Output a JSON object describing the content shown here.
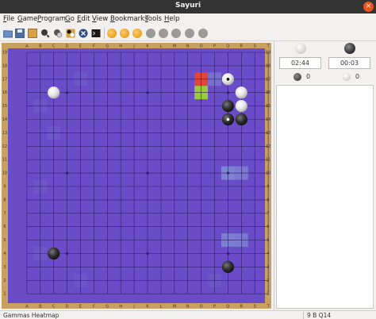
{
  "window": {
    "title": "Sayuri",
    "close_glyph": "×"
  },
  "menu": [
    "File",
    "Game",
    "Program",
    "Go",
    "Edit",
    "View",
    "Bookmarks",
    "Tools",
    "Help"
  ],
  "toolbar": {
    "buttons": [
      "open-icon",
      "save-icon",
      "board-icon",
      "analyze-icon",
      "setup-icon",
      "stop-icon",
      "terminal-icon",
      "play-orange-icon",
      "play-orange-icon-2",
      "play-orange-icon-3",
      "disabled-icon-1",
      "disabled-icon-2",
      "disabled-icon-3",
      "disabled-icon-4",
      "disabled-icon-5"
    ]
  },
  "board": {
    "size": 19,
    "col_labels": [
      "A",
      "B",
      "C",
      "D",
      "E",
      "F",
      "G",
      "H",
      "J",
      "K",
      "L",
      "M",
      "N",
      "O",
      "P",
      "Q",
      "R",
      "S",
      "T"
    ],
    "row_labels": [
      "19",
      "18",
      "17",
      "16",
      "15",
      "14",
      "13",
      "12",
      "11",
      "10",
      "9",
      "8",
      "7",
      "6",
      "5",
      "4",
      "3",
      "2",
      "1"
    ],
    "colors": {
      "wood": "#c8a060",
      "board": "#6a4cc8",
      "line": "#2e1f66",
      "heat": "#8fb0d9"
    },
    "stones": [
      {
        "color": "white",
        "col": 16,
        "row": 17
      },
      {
        "color": "white",
        "col": 3,
        "row": 16
      },
      {
        "color": "white",
        "col": 17,
        "row": 16
      },
      {
        "color": "white",
        "col": 17,
        "row": 15
      },
      {
        "color": "black",
        "col": 16,
        "row": 15
      },
      {
        "color": "black",
        "col": 16,
        "row": 14
      },
      {
        "color": "black",
        "col": 17,
        "row": 14
      },
      {
        "color": "black",
        "col": 3,
        "row": 4
      },
      {
        "color": "black",
        "col": 16,
        "row": 3
      }
    ],
    "markers": [
      {
        "col": 16,
        "row": 17,
        "color": "black"
      },
      {
        "col": 16,
        "row": 14,
        "color": "white"
      }
    ],
    "highlights": [
      {
        "col": 14,
        "row": 17,
        "color": "#e0453a"
      },
      {
        "col": 14,
        "row": 16,
        "color": "#9cc93c"
      }
    ],
    "heat": [
      {
        "col": 16,
        "row": 10,
        "strength": 0.55
      },
      {
        "col": 17,
        "row": 10,
        "strength": 0.45
      },
      {
        "col": 16,
        "row": 5,
        "strength": 0.5
      },
      {
        "col": 17,
        "row": 5,
        "strength": 0.45
      },
      {
        "col": 15,
        "row": 17,
        "strength": 0.35
      },
      {
        "col": 5,
        "row": 17,
        "strength": 0.12
      },
      {
        "col": 2,
        "row": 15,
        "strength": 0.1
      },
      {
        "col": 3,
        "row": 13,
        "strength": 0.1
      },
      {
        "col": 2,
        "row": 9,
        "strength": 0.1
      },
      {
        "col": 2,
        "row": 4,
        "strength": 0.1
      },
      {
        "col": 5,
        "row": 2,
        "strength": 0.1
      },
      {
        "col": 15,
        "row": 2,
        "strength": 0.1
      }
    ]
  },
  "side_panel": {
    "white_time": "02:44",
    "black_time": "00:03",
    "black_captures": "0",
    "white_captures": "0"
  },
  "status": {
    "left": "Gammas Heatmap",
    "right": "9 B Q14"
  }
}
